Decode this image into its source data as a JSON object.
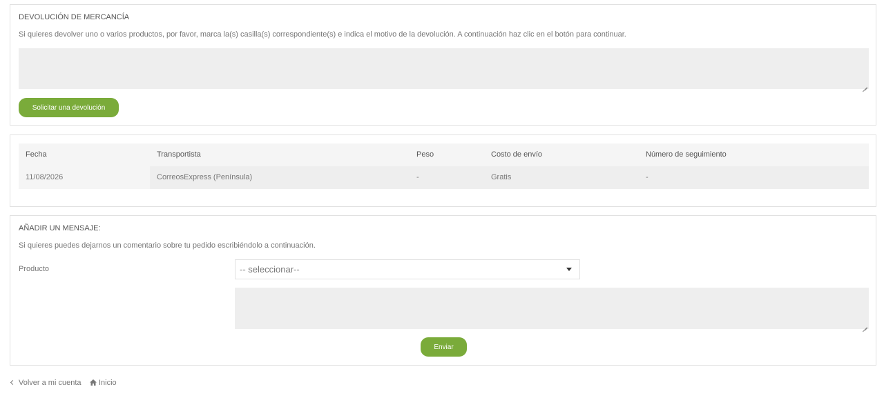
{
  "return_section": {
    "title": "DEVOLUCIÓN DE MERCANCÍA",
    "description": "Si quieres devolver uno o varios productos, por favor, marca la(s) casilla(s) correspondiente(s) e indica el motivo de la devolución. A continuación haz clic en el botón para continuar.",
    "textarea_value": "",
    "button_label": "Solicitar una devolución"
  },
  "shipping_table": {
    "headers": [
      "Fecha",
      "Transportista",
      "Peso",
      "Costo de envío",
      "Número de seguimiento"
    ],
    "rows": [
      [
        "11/08/2026",
        "CorreosExpress (Península)",
        "-",
        "Gratis",
        "-"
      ]
    ]
  },
  "message_section": {
    "title": "AÑADIR UN MENSAJE:",
    "description": "Si quieres puedes dejarnos un comentario sobre tu pedido escribiéndolo a continuación.",
    "product_label": "Producto",
    "product_select_value": "-- seleccionar--",
    "textarea_value": "",
    "send_label": "Enviar"
  },
  "footer": {
    "back_label": "Volver a mi cuenta",
    "home_label": "Inicio"
  },
  "colors": {
    "accent_green": "#7aab3a",
    "field_bg": "#eeeeee",
    "border": "#e1e1e1"
  }
}
